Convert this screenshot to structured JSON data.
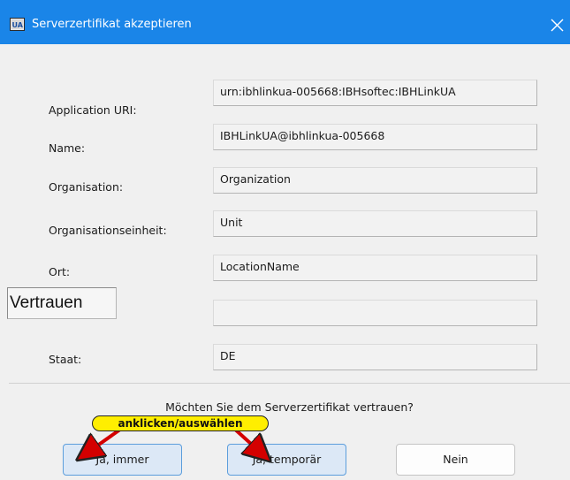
{
  "window": {
    "title": "Serverzertifikat akzeptieren",
    "icon": "app-icon",
    "close_icon": "close-icon"
  },
  "fields": [
    {
      "label": "Application URI:",
      "value": "urn:ibhlinkua-005668:IBHsoftec:IBHLinkUA"
    },
    {
      "label": "Name:",
      "value": "IBHLinkUA@ibhlinkua-005668"
    },
    {
      "label": "Organisation:",
      "value": "Organization"
    },
    {
      "label": "Organisationseinheit:",
      "value": "Unit"
    },
    {
      "label": "Ort:",
      "value": "LocationName"
    },
    {
      "label": "",
      "value": ""
    },
    {
      "label": "Staat:",
      "value": "DE"
    }
  ],
  "overlay_label": "Vertrauen",
  "question": "Möchten Sie dem Serverzertifikat vertrauen?",
  "callout": "anklicken/auswählen",
  "buttons": {
    "always": "Ja, immer",
    "temporary": "Ja, temporär",
    "no": "Nein"
  },
  "colors": {
    "titlebar": "#1a85e8",
    "dialog_bg": "#f0f0f0",
    "primary_button_bg": "#dce8f6",
    "primary_button_border": "#5c9edc",
    "callout_bg": "#ffee00",
    "arrow": "#d40000"
  }
}
